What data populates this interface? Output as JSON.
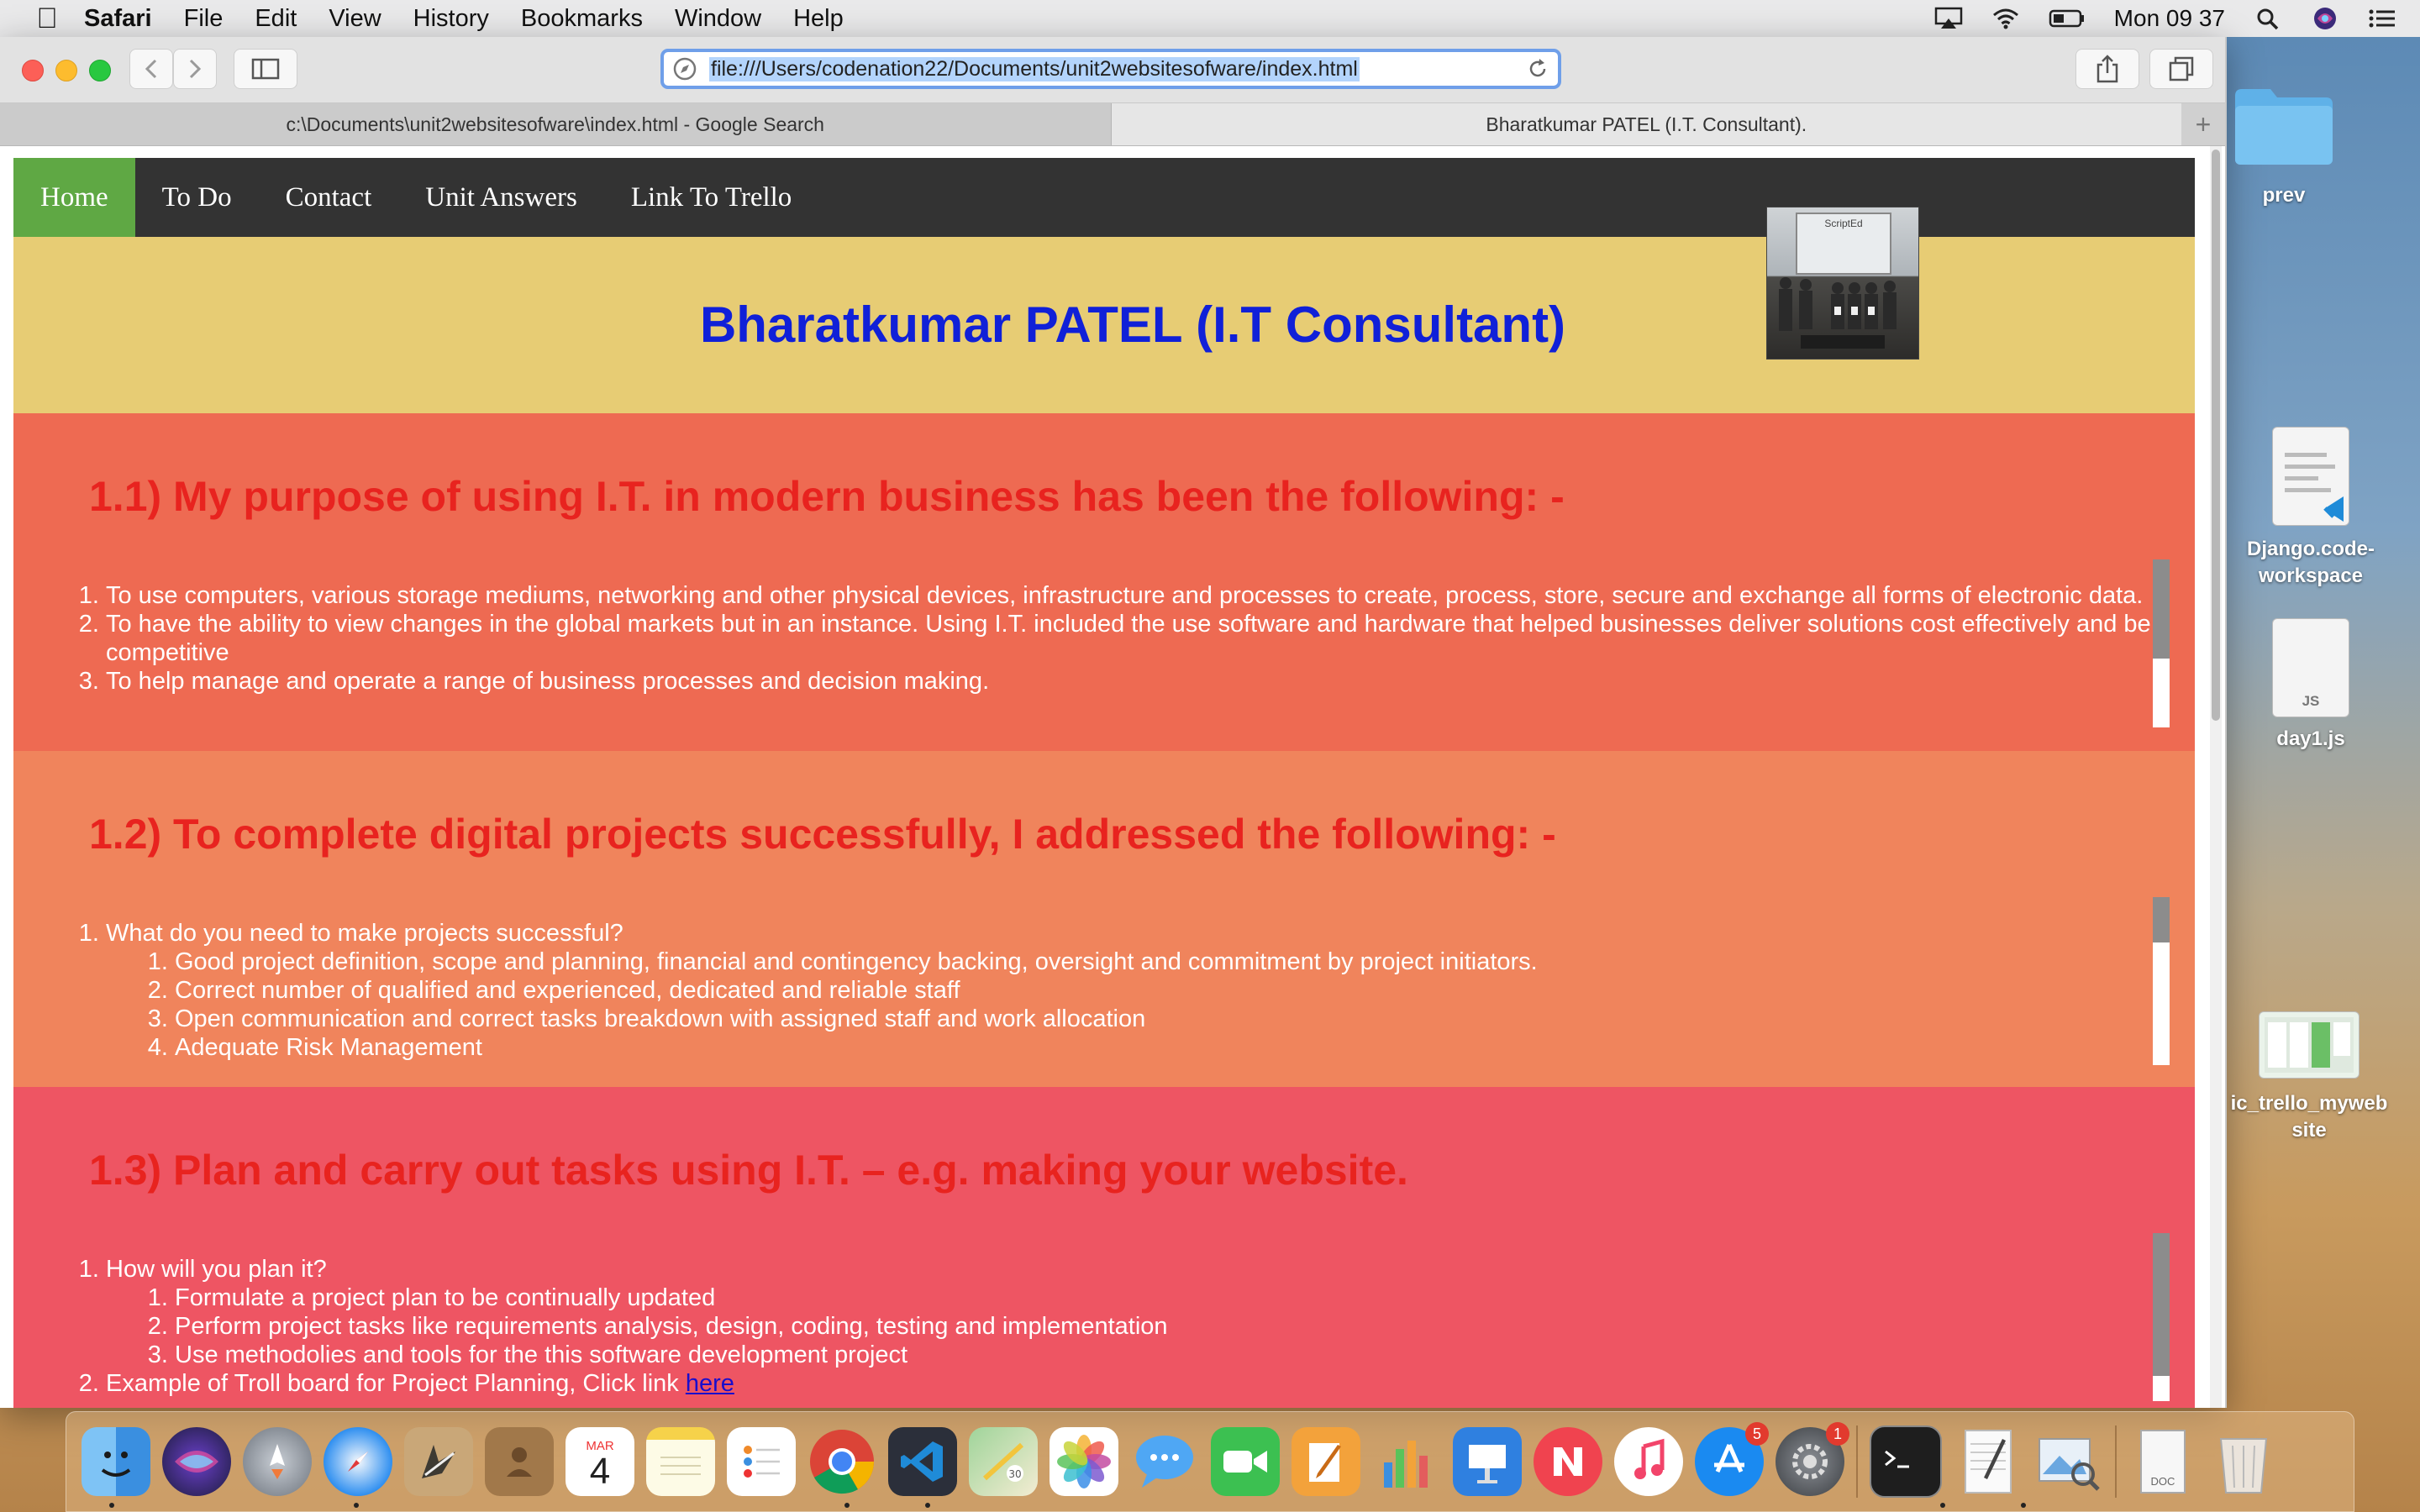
{
  "menubar": {
    "app": "Safari",
    "items": [
      "File",
      "Edit",
      "View",
      "History",
      "Bookmarks",
      "Window",
      "Help"
    ],
    "clock": "Mon 09 37"
  },
  "browser": {
    "url": "file:///Users/codenation22/Documents/unit2websitesofware/index.html",
    "tabs": [
      {
        "title": "c:\\Documents\\unit2websitesofware\\index.html - Google Search",
        "active": false
      },
      {
        "title": "Bharatkumar PATEL (I.T. Consultant).",
        "active": true
      }
    ],
    "new_tab": "+"
  },
  "page": {
    "nav": [
      "Home",
      "To Do",
      "Contact",
      "Unit Answers",
      "Link To Trello"
    ],
    "photo_caption": "ScriptEd",
    "heading": "Bharatkumar PATEL (I.T Consultant)",
    "sections": [
      {
        "title": "1.1) My purpose of using I.T. in modern business has been the following: -",
        "items": [
          "To use computers, various storage mediums, networking and other physical devices, infrastructure and processes to create, process, store, secure and exchange all forms of electronic data.",
          "To have the ability to view changes in the global markets but in an instance. Using I.T. included the use software and hardware that helped businesses deliver solutions cost effectively and be competitive",
          "To help manage and operate a range of business processes and decision making."
        ]
      },
      {
        "title": "1.2) To complete digital projects successfully, I addressed the following: -",
        "question": "What do you need to make projects successful?",
        "subitems": [
          "Good project definition, scope and planning, financial and contingency backing, oversight and commitment by project initiators.",
          "Correct number of qualified and experienced, dedicated and reliable staff",
          "Open communication and correct tasks breakdown with assigned staff and work allocation",
          "Adequate Risk Management"
        ]
      },
      {
        "title": "1.3) Plan and carry out tasks using I.T. – e.g. making your website.",
        "question": "How will you plan it?",
        "subitems": [
          "Formulate a project plan to be continually updated",
          "Perform project tasks like requirements analysis, design, coding, testing and implementation",
          "Use methodolies and tools for the this software development project"
        ],
        "item2_text": "Example of Troll board for Project Planning, Click link ",
        "item2_link": "here"
      }
    ]
  },
  "desktop": {
    "icons": [
      {
        "label": "prev",
        "kind": "folder"
      },
      {
        "label": "Django.code-workspace",
        "kind": "vscode-file"
      },
      {
        "label": "day1.js",
        "kind": "js-file",
        "tag": "JS"
      },
      {
        "label": "ic_trello_mywebsite",
        "kind": "image-file"
      }
    ]
  },
  "dock": {
    "calendar_month": "MAR",
    "calendar_day": "4",
    "app_store_badge": "5",
    "settings_badge": "1",
    "doc_tag": "DOC",
    "apps": [
      "Finder",
      "Siri",
      "Launchpad",
      "Safari",
      "Mail",
      "Contacts",
      "Calendar",
      "Notes",
      "Reminders",
      "Chrome",
      "VS Code",
      "Maps",
      "Photos",
      "Messages",
      "FaceTime",
      "Pages",
      "Numbers",
      "Keynote",
      "News",
      "Music",
      "App Store",
      "System Preferences",
      "Terminal",
      "TextEdit",
      "Preview",
      "Document",
      "Trash"
    ]
  },
  "colors": {
    "nav_bg": "#333333",
    "nav_active": "#5fa844",
    "header_bg": "#e7cc74",
    "heading": "#1020d8",
    "section_title": "#e8231f",
    "s1_bg": "#ee6a52",
    "s2_bg": "#f0845c",
    "s3_bg": "#ee5563"
  }
}
